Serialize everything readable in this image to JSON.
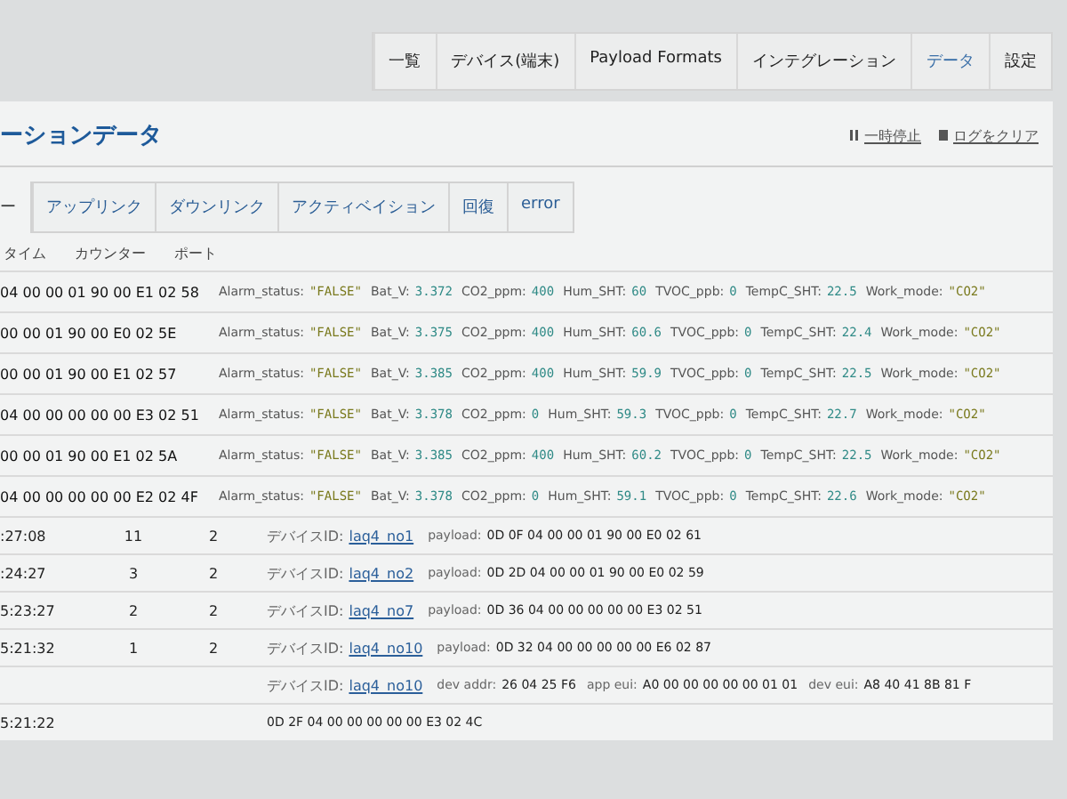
{
  "nav": [
    {
      "label": "一覧",
      "selected": false
    },
    {
      "label": "デバイス(端末)",
      "selected": false
    },
    {
      "label": "Payload Formats",
      "selected": false
    },
    {
      "label": "インテグレーション",
      "selected": false
    },
    {
      "label": "データ",
      "selected": true
    },
    {
      "label": "設定",
      "selected": false
    }
  ],
  "title": "ーションデータ",
  "actions": [
    {
      "label": "一時停止",
      "kind": "pause"
    },
    {
      "label": "ログをクリア",
      "kind": "clear"
    }
  ],
  "filters": [
    {
      "label": "ー",
      "selected": false
    },
    {
      "label": "アップリンク",
      "selected": false
    },
    {
      "label": "ダウンリンク",
      "selected": false
    },
    {
      "label": "アクティベイション",
      "selected": false
    },
    {
      "label": "回復",
      "selected": false
    },
    {
      "label": "error",
      "selected": false
    }
  ],
  "columns": [
    "タイム",
    "カウンター",
    "ポート"
  ],
  "decoded_rows": [
    {
      "payload": "04 00 00 01 90 00 E1 02 58",
      "fields": [
        {
          "key": "Alarm_status:",
          "value": "\"FALSE\"",
          "kind": "string"
        },
        {
          "key": "Bat_V:",
          "value": "3.372",
          "kind": "number"
        },
        {
          "key": "CO2_ppm:",
          "value": "400",
          "kind": "number"
        },
        {
          "key": "Hum_SHT:",
          "value": "60",
          "kind": "number"
        },
        {
          "key": "TVOC_ppb:",
          "value": "0",
          "kind": "number"
        },
        {
          "key": "TempC_SHT:",
          "value": "22.5",
          "kind": "number"
        },
        {
          "key": "Work_mode:",
          "value": "\"CO2\"",
          "kind": "string"
        }
      ]
    },
    {
      "payload": "00 00 01 90 00 E0 02 5E",
      "fields": [
        {
          "key": "Alarm_status:",
          "value": "\"FALSE\"",
          "kind": "string"
        },
        {
          "key": "Bat_V:",
          "value": "3.375",
          "kind": "number"
        },
        {
          "key": "CO2_ppm:",
          "value": "400",
          "kind": "number"
        },
        {
          "key": "Hum_SHT:",
          "value": "60.6",
          "kind": "number"
        },
        {
          "key": "TVOC_ppb:",
          "value": "0",
          "kind": "number"
        },
        {
          "key": "TempC_SHT:",
          "value": "22.4",
          "kind": "number"
        },
        {
          "key": "Work_mode:",
          "value": "\"CO2\"",
          "kind": "string"
        }
      ]
    },
    {
      "payload": "00 00 01 90 00 E1 02 57",
      "fields": [
        {
          "key": "Alarm_status:",
          "value": "\"FALSE\"",
          "kind": "string"
        },
        {
          "key": "Bat_V:",
          "value": "3.385",
          "kind": "number"
        },
        {
          "key": "CO2_ppm:",
          "value": "400",
          "kind": "number"
        },
        {
          "key": "Hum_SHT:",
          "value": "59.9",
          "kind": "number"
        },
        {
          "key": "TVOC_ppb:",
          "value": "0",
          "kind": "number"
        },
        {
          "key": "TempC_SHT:",
          "value": "22.5",
          "kind": "number"
        },
        {
          "key": "Work_mode:",
          "value": "\"CO2\"",
          "kind": "string"
        }
      ]
    },
    {
      "payload": "04 00 00 00 00 00 E3 02 51",
      "fields": [
        {
          "key": "Alarm_status:",
          "value": "\"FALSE\"",
          "kind": "string"
        },
        {
          "key": "Bat_V:",
          "value": "3.378",
          "kind": "number"
        },
        {
          "key": "CO2_ppm:",
          "value": "0",
          "kind": "number"
        },
        {
          "key": "Hum_SHT:",
          "value": "59.3",
          "kind": "number"
        },
        {
          "key": "TVOC_ppb:",
          "value": "0",
          "kind": "number"
        },
        {
          "key": "TempC_SHT:",
          "value": "22.7",
          "kind": "number"
        },
        {
          "key": "Work_mode:",
          "value": "\"CO2\"",
          "kind": "string"
        }
      ]
    },
    {
      "payload": "00 00 01 90 00 E1 02 5A",
      "fields": [
        {
          "key": "Alarm_status:",
          "value": "\"FALSE\"",
          "kind": "string"
        },
        {
          "key": "Bat_V:",
          "value": "3.385",
          "kind": "number"
        },
        {
          "key": "CO2_ppm:",
          "value": "400",
          "kind": "number"
        },
        {
          "key": "Hum_SHT:",
          "value": "60.2",
          "kind": "number"
        },
        {
          "key": "TVOC_ppb:",
          "value": "0",
          "kind": "number"
        },
        {
          "key": "TempC_SHT:",
          "value": "22.5",
          "kind": "number"
        },
        {
          "key": "Work_mode:",
          "value": "\"CO2\"",
          "kind": "string"
        }
      ]
    },
    {
      "payload": "04 00 00 00 00 00 E2 02 4F",
      "fields": [
        {
          "key": "Alarm_status:",
          "value": "\"FALSE\"",
          "kind": "string"
        },
        {
          "key": "Bat_V:",
          "value": "3.378",
          "kind": "number"
        },
        {
          "key": "CO2_ppm:",
          "value": "0",
          "kind": "number"
        },
        {
          "key": "Hum_SHT:",
          "value": "59.1",
          "kind": "number"
        },
        {
          "key": "TVOC_ppb:",
          "value": "0",
          "kind": "number"
        },
        {
          "key": "TempC_SHT:",
          "value": "22.6",
          "kind": "number"
        },
        {
          "key": "Work_mode:",
          "value": "\"CO2\"",
          "kind": "string"
        }
      ]
    }
  ],
  "log_rows": [
    {
      "time": ":27:08",
      "counter": "11",
      "port": "2",
      "device_label": "デバイスID:",
      "device_id": "laq4_no1",
      "details": [
        {
          "key": "payload:",
          "value": "0D 0F 04 00 00 01 90 00 E0 02 61"
        }
      ]
    },
    {
      "time": ":24:27",
      "counter": "3",
      "port": "2",
      "device_label": "デバイスID:",
      "device_id": "laq4_no2",
      "details": [
        {
          "key": "payload:",
          "value": "0D 2D 04 00 00 01 90 00 E0 02 59"
        }
      ]
    },
    {
      "time": "5:23:27",
      "counter": "2",
      "port": "2",
      "device_label": "デバイスID:",
      "device_id": "laq4_no7",
      "details": [
        {
          "key": "payload:",
          "value": "0D 36 04 00 00 00 00 00 E3 02 51"
        }
      ]
    },
    {
      "time": "5:21:32",
      "counter": "1",
      "port": "2",
      "device_label": "デバイスID:",
      "device_id": "laq4_no10",
      "details": [
        {
          "key": "payload:",
          "value": "0D 32 04 00 00 00 00 00 E6 02 87"
        }
      ]
    },
    {
      "time": "",
      "counter": "",
      "port": "",
      "device_label": "デバイスID:",
      "device_id": "laq4_no10",
      "details": [
        {
          "key": "dev addr:",
          "value": "26 04 25 F6"
        },
        {
          "key": "app eui:",
          "value": "A0 00 00 00 00 00 01 01"
        },
        {
          "key": "dev eui:",
          "value": "A8 40 41 8B 81 F"
        }
      ]
    },
    {
      "time": "5:21:22",
      "counter": "",
      "port": "",
      "device_label": "",
      "device_id": "",
      "details": [
        {
          "value": "0D 2F 04 00 00 00 00 00 E3 02 4C"
        }
      ]
    }
  ]
}
